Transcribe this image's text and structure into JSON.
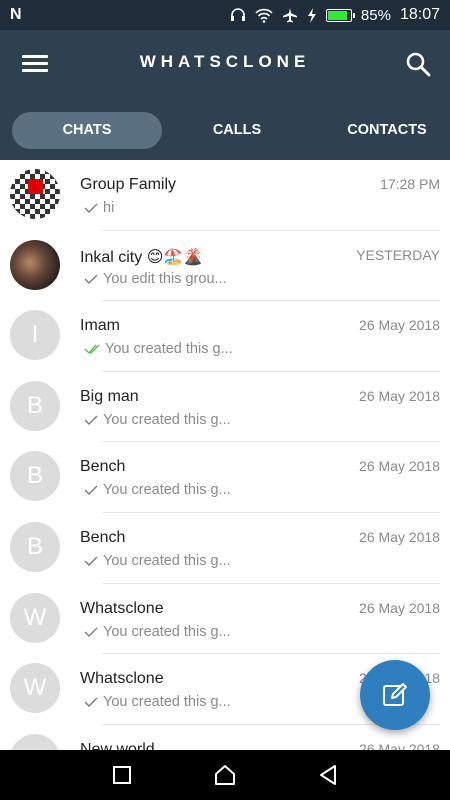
{
  "status_bar": {
    "carrier": "N",
    "battery": "85%",
    "battery_fraction": 0.85,
    "time": "18:07"
  },
  "app_bar": {
    "title": "WHATSCLONE",
    "tabs": [
      {
        "label": "CHATS",
        "active": true
      },
      {
        "label": "CALLS",
        "active": false
      },
      {
        "label": "CONTACTS",
        "active": false
      }
    ]
  },
  "chats": [
    {
      "name": "Group Family",
      "time": "17:28 PM",
      "preview": "hi",
      "avatar_letter": "",
      "read": false
    },
    {
      "name": "Inkal city",
      "name_emoji": "😊🏖️🌋",
      "time": "YESTERDAY",
      "preview": "You edit this grou...",
      "avatar_letter": "",
      "read": false
    },
    {
      "name": "Imam",
      "time": "26 May 2018",
      "preview": "You created this g...",
      "avatar_letter": "I",
      "read": true
    },
    {
      "name": "Big man",
      "time": "26 May 2018",
      "preview": "You created this g...",
      "avatar_letter": "B",
      "read": false
    },
    {
      "name": "Bench",
      "time": "26 May 2018",
      "preview": "You created this g...",
      "avatar_letter": "B",
      "read": false
    },
    {
      "name": "Bench",
      "time": "26 May 2018",
      "preview": "You created this g...",
      "avatar_letter": "B",
      "read": false
    },
    {
      "name": "Whatsclone",
      "time": "26 May 2018",
      "preview": "You created this g...",
      "avatar_letter": "W",
      "read": false
    },
    {
      "name": "Whatsclone",
      "time": "26 May 2018",
      "preview": "You created this g...",
      "avatar_letter": "W",
      "read": false
    },
    {
      "name": "New world",
      "time": "26 May 2018",
      "preview": "",
      "avatar_letter": "",
      "read": false
    }
  ],
  "colors": {
    "app_bar": "#2f4150",
    "status_bar": "#1f2d3a",
    "tab_active": "#5b7080",
    "fab": "#2f7fc0",
    "check_sent": "#7a7a7a",
    "check_read": "#4fc24f"
  },
  "icons": {
    "menu": "hamburger-icon",
    "search": "search-icon",
    "fab": "edit-icon",
    "nav": [
      "square-recents-icon",
      "home-icon",
      "back-icon"
    ]
  }
}
